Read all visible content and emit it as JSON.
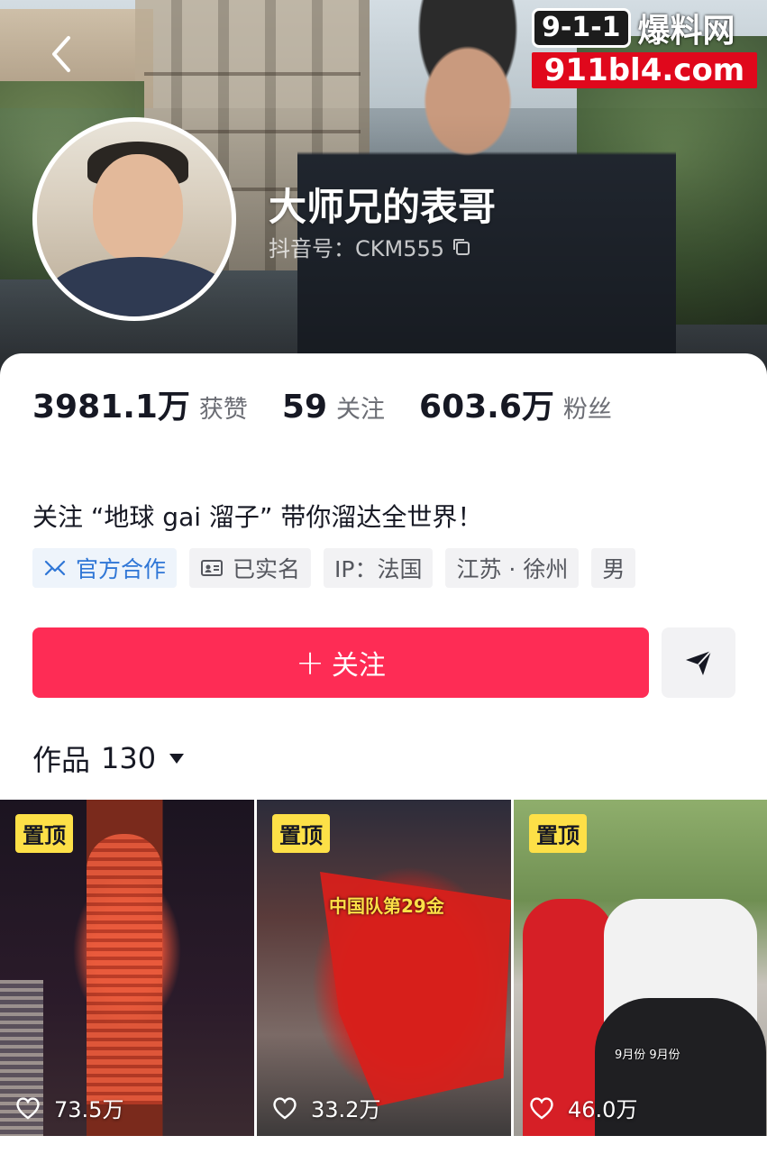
{
  "watermark": {
    "box_text": "9-1-1",
    "cn_text": "爆料网",
    "url_text": "911bl4.com"
  },
  "profile": {
    "nickname": "大师兄的表哥",
    "douyin_id": "抖音号：CKM555"
  },
  "stats": [
    {
      "value": "3981.1万",
      "label": "获赞"
    },
    {
      "value": "59",
      "label": "关注"
    },
    {
      "value": "603.6万",
      "label": "粉丝"
    }
  ],
  "bio": "关注 “地球 gai 溜子” 带你溜达全世界！",
  "tags": [
    {
      "label": "官方合作",
      "icon": "official-cooperation-icon"
    },
    {
      "label": "已实名",
      "icon": "id-card-icon"
    },
    {
      "label": "IP：法国"
    },
    {
      "label": "江苏 · 徐州"
    },
    {
      "label": "男"
    }
  ],
  "actions": {
    "follow_label": "关注",
    "follow_plus": "+"
  },
  "works": {
    "title": "作品",
    "count": "130"
  },
  "videos": [
    {
      "pin": "置顶",
      "likes": "73.5万"
    },
    {
      "pin": "置顶",
      "likes": "33.2万",
      "overlay_text": "中国队第29金"
    },
    {
      "pin": "置顶",
      "likes": "46.0万",
      "overlay_text": "9月份 9月份"
    }
  ],
  "colors": {
    "follow_button": "#fe2c55",
    "pin_badge": "#fde047",
    "official_tag": "#2f76d6",
    "watermark_red": "#e0081c"
  }
}
